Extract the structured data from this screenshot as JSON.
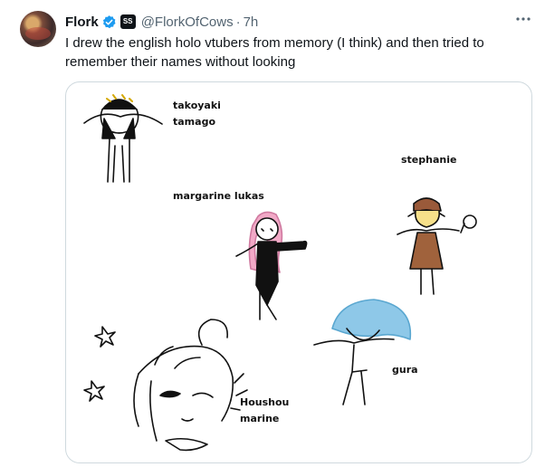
{
  "tweet": {
    "author_name": "Flork",
    "handle": "@FlorkOfCows",
    "separator": "·",
    "time": "7h",
    "text": "I drew the english holo vtubers from memory (I think) and then tried to remember their names without looking",
    "affiliate_badge_text": "SS"
  },
  "drawing": {
    "labels": {
      "takoyaki_line1": "takoyaki",
      "takoyaki_line2": "tamago",
      "stephanie": "stephanie",
      "margarine": "margarine lukas",
      "gura": "gura",
      "houshou_line1": "Houshou",
      "houshou_line2": "marine"
    }
  },
  "colors": {
    "verified_blue": "#1d9bf0",
    "secondary_text": "#536471",
    "media_border": "#cfd9de"
  },
  "icons": {
    "verified": "verified-badge-icon",
    "more": "more-options-icon"
  }
}
